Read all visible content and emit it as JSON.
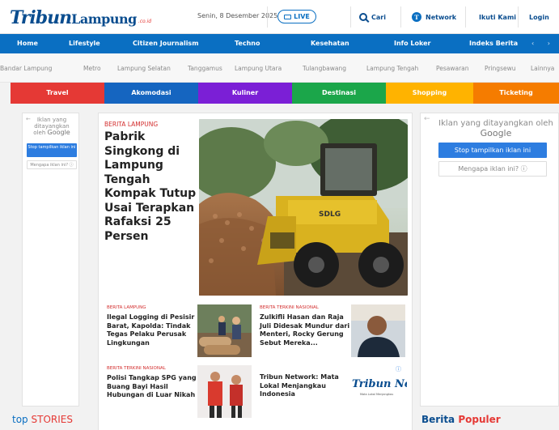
{
  "header": {
    "logo_main": "Tribun",
    "logo_sub": "Lampung",
    "logo_suffix": ".co.id",
    "date": "Senin, 8 Desember 2025",
    "live_label": "LIVE",
    "search_label": "Cari",
    "network_label": "Network",
    "follow_label": "Ikuti Kami",
    "login_label": "Login"
  },
  "main_nav": [
    "Home",
    "Lifestyle",
    "Citizen Journalism",
    "Techno",
    "Kesehatan",
    "Info Loker",
    "Indeks Berita"
  ],
  "nav_arrows": "‹ ›",
  "region_nav": [
    "Bandar Lampung",
    "Metro",
    "Lampung Selatan",
    "Tanggamus",
    "Lampung Utara",
    "Tulangbawang",
    "Lampung Tengah",
    "Pesawaran",
    "Pringsewu",
    "Lainnya"
  ],
  "categories": [
    {
      "label": "Travel",
      "color": "#e53935"
    },
    {
      "label": "Akomodasi",
      "color": "#1565c0"
    },
    {
      "label": "Kuliner",
      "color": "#7b1fd6"
    },
    {
      "label": "Destinasi",
      "color": "#1ba64a"
    },
    {
      "label": "Shopping",
      "color": "#ffb300"
    },
    {
      "label": "Ticketing",
      "color": "#f57c00"
    }
  ],
  "ad_left": {
    "close": "←",
    "line1": "Iklan yang ditayangkan oleh",
    "brand": "Google",
    "stop": "Stop tampilkan iklan ini",
    "why": "Mengapa iklan ini? ⓘ"
  },
  "ad_right": {
    "close": "←",
    "line1": "Iklan yang ditayangkan oleh",
    "brand": "Google",
    "stop": "Stop tampilkan iklan ini",
    "why": "Mengapa iklan ini? ⓘ"
  },
  "headline": {
    "kicker": "BERITA LAMPUNG",
    "title": "Pabrik Singkong di Lampung Tengah Kompak Tutup Usai Terapkan Rafaksi 25 Persen"
  },
  "articles": [
    {
      "kicker": "BERITA LAMPUNG",
      "title": "Ilegal Logging di Pesisir Barat, Kapolda: Tindak Tegas Pelaku Perusak Lingkungan"
    },
    {
      "kicker": "BERITA TERKINI NASIONAL",
      "title": "Zulkifli Hasan dan Raja Juli Didesak Mundur dari Menteri, Rocky Gerung Sebut Mereka..."
    },
    {
      "kicker": "BERITA TERKINI NASIONAL",
      "title": "Polisi Tangkap SPG yang Buang Bayi Hasil Hubungan di Luar Nikah"
    },
    {
      "kicker": "",
      "title": "Tribun Network: Mata Lokal Menjangkau Indonesia"
    }
  ],
  "network_thumb": {
    "brand": "Tribun Netw",
    "tagline": "Mata Lokal Menjangkau"
  },
  "sections": {
    "top_stories_a": "top",
    "top_stories_b": "STORIES",
    "popular_a": "Berita",
    "popular_b": "Populer"
  },
  "colors": {
    "brand_blue": "#0a6fc2",
    "dark_blue": "#0a4d8f",
    "kicker_red": "#d32f2f"
  }
}
